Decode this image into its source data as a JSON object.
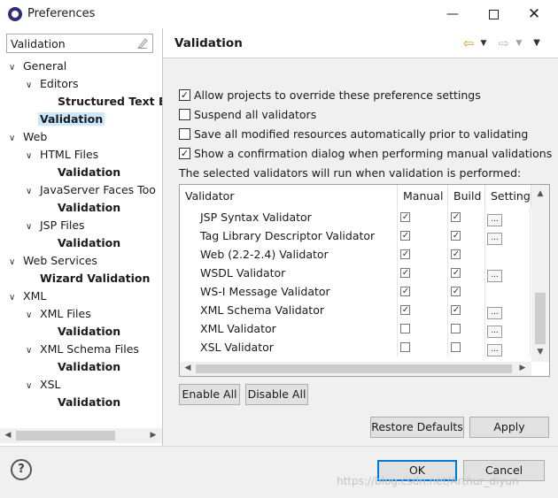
{
  "window": {
    "title": "Preferences"
  },
  "sidebar": {
    "filter_value": "Validation",
    "tree": [
      {
        "label": "General",
        "twisty": "v"
      },
      {
        "label": "Editors",
        "twisty": "v"
      },
      {
        "label": "Structured Text E",
        "twisty": ""
      },
      {
        "label": "Validation",
        "twisty": ""
      },
      {
        "label": "Web",
        "twisty": "v"
      },
      {
        "label": "HTML Files",
        "twisty": "v"
      },
      {
        "label": "Validation",
        "twisty": ""
      },
      {
        "label": "JavaServer Faces Too",
        "twisty": "v"
      },
      {
        "label": "Validation",
        "twisty": ""
      },
      {
        "label": "JSP Files",
        "twisty": "v"
      },
      {
        "label": "Validation",
        "twisty": ""
      },
      {
        "label": "Web Services",
        "twisty": "v"
      },
      {
        "label": "Wizard Validation",
        "twisty": ""
      },
      {
        "label": "XML",
        "twisty": "v"
      },
      {
        "label": "XML Files",
        "twisty": "v"
      },
      {
        "label": "Validation",
        "twisty": ""
      },
      {
        "label": "XML Schema Files",
        "twisty": "v"
      },
      {
        "label": "Validation",
        "twisty": ""
      },
      {
        "label": "XSL",
        "twisty": "v"
      },
      {
        "label": "Validation",
        "twisty": ""
      }
    ]
  },
  "page": {
    "title": "Validation",
    "checkboxes": [
      {
        "label": "Allow projects to override these preference settings",
        "checked": true
      },
      {
        "label": "Suspend all validators",
        "checked": false
      },
      {
        "label": "Save all modified resources automatically prior to validating",
        "checked": false
      },
      {
        "label": "Show a confirmation dialog when performing manual validations",
        "checked": true
      }
    ],
    "info": "The selected validators will run when validation is performed:",
    "table": {
      "headers": [
        "Validator",
        "Manual",
        "Build",
        "Settings"
      ],
      "rows": [
        {
          "name": "JSP Syntax Validator",
          "manual": true,
          "build": true,
          "settings": true
        },
        {
          "name": "Tag Library Descriptor Validator",
          "manual": true,
          "build": true,
          "settings": true
        },
        {
          "name": "Web (2.2-2.4) Validator",
          "manual": true,
          "build": true,
          "settings": false
        },
        {
          "name": "WSDL Validator",
          "manual": true,
          "build": true,
          "settings": true
        },
        {
          "name": "WS-I Message Validator",
          "manual": true,
          "build": true,
          "settings": false
        },
        {
          "name": "XML Schema Validator",
          "manual": true,
          "build": true,
          "settings": true
        },
        {
          "name": "XML Validator",
          "manual": false,
          "build": false,
          "settings": true
        },
        {
          "name": "XSL Validator",
          "manual": false,
          "build": false,
          "settings": true
        }
      ]
    },
    "enable_all": "Enable All",
    "disable_all": "Disable All",
    "restore_defaults": "Restore Defaults",
    "apply": "Apply"
  },
  "footer": {
    "help": "?",
    "ok": "OK",
    "cancel": "Cancel",
    "watermark": "https://blog.csdn.net/Arthur_diyun"
  },
  "colors": {
    "selection": "#cce8ff",
    "default_button_border": "#0078d7",
    "back_arrow": "#d39a1a"
  }
}
